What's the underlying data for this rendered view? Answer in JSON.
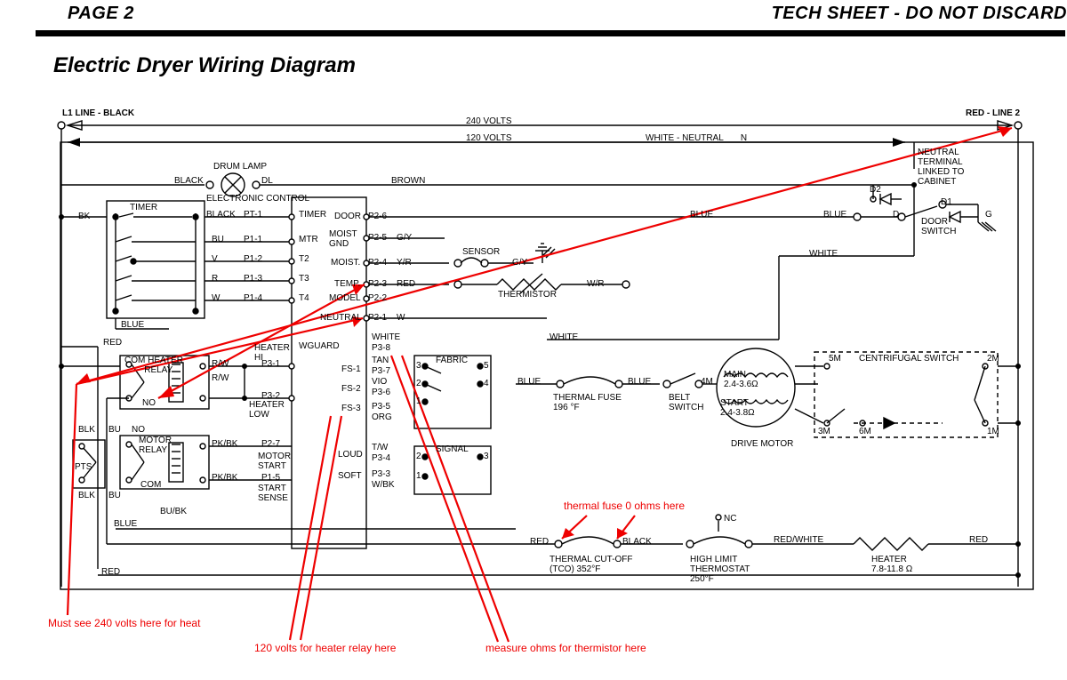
{
  "header": {
    "page": "PAGE 2",
    "tech": "TECH SHEET - DO NOT DISCARD",
    "title": "Electric Dryer Wiring Diagram"
  },
  "lines": {
    "l1": "L1 LINE - BLACK",
    "l2": "RED - LINE 2",
    "v240": "240 VOLTS",
    "v120": "120 VOLTS",
    "neutral": "WHITE - NEUTRAL       N",
    "neutralCab": "NEUTRAL\nTERMINAL\nLINKED TO\nCABINET"
  },
  "parts": {
    "drumLamp": "DRUM LAMP",
    "dl": "DL",
    "timer": "TIMER",
    "electronicControl": "ELECTRONIC CONTROL",
    "door": "DOOR",
    "doorSwitch": "DOOR\nSWITCH",
    "moistGnd": "MOIST\nGND",
    "moist": "MOIST.",
    "temp": "TEMP.",
    "model": "MODEL",
    "neutralPin": "NEUTRAL",
    "sensor": "SENSOR",
    "thermistor": "THERMISTOR",
    "wguard": "WGUARD",
    "fabric": "FABRIC",
    "signal": "SIGNAL",
    "heaterRelay": "COM HEATER\n        RELAY",
    "heaterHi": "HEATER\nHI",
    "heaterLow": "HEATER\nLOW",
    "motorRelay": "MOTOR\nRELAY",
    "motorStart": "MOTOR\nSTART",
    "startSense": "START\nSENSE",
    "loud": "LOUD",
    "soft": "SOFT",
    "thermalFuse": "THERMAL FUSE\n196 °F",
    "beltSwitch": "BELT\nSWITCH",
    "driveMotor": "DRIVE MOTOR",
    "main": "MAIN\n2.4-3.6Ω",
    "start": "START\n2.4-3.8Ω",
    "centSwitch": "CENTRIFUGAL SWITCH",
    "tco": "THERMAL CUT-OFF\n(TCO) 352°F",
    "hiLimit": "HIGH LIMIT\nTHERMOSTAT\n250°F",
    "heater": "HEATER\n7.8-11.8 Ω",
    "d1": "D1",
    "d2": "D2",
    "g": "G",
    "nc": "NC"
  },
  "wires": {
    "black": "BLACK",
    "brown": "BROWN",
    "blue": "BLUE",
    "white": "WHITE",
    "red": "RED",
    "blk": "BLK",
    "bu": "BU",
    "bk": "BK",
    "rw": "R/W",
    "wr": "W/R",
    "yr": "Y/R",
    "gy": "G/Y",
    "pkbk": "PK/BK",
    "bubk": "BU/BK",
    "tw": "T/W",
    "wbk": "W/BK",
    "tan": "TAN",
    "vio": "VIO",
    "org": "ORG",
    "w": "W",
    "redwhite": "RED/WHITE",
    "v": "V",
    "r": "R",
    "d": "D"
  },
  "pins": {
    "pt1": "PT-1",
    "p11": "P1-1",
    "p12": "P1-2",
    "p13": "P1-3",
    "p14": "P1-4",
    "p15": "P1-5",
    "p21": "P2-1",
    "p22": "P2-2",
    "p23": "P2-3",
    "p24": "P2-4",
    "p25": "P2-5",
    "p26": "P2-6",
    "p27": "P2-7",
    "p31": "P3-1",
    "p32": "P3-2",
    "p33": "P3-3",
    "p34": "P3-4",
    "p35": "P3-5",
    "p36": "P3-6",
    "p37": "P3-7",
    "p38": "P3-8",
    "fs1": "FS-1",
    "fs2": "FS-2",
    "fs3": "FS-3",
    "mtr": "MTR",
    "t2": "T2",
    "t3": "T3",
    "t4": "T4",
    "m1": "1M",
    "m2": "2M",
    "m3": "3M",
    "m4": "4M",
    "m5": "5M",
    "m6": "6M",
    "com": "COM",
    "no": "NO",
    "pts": "PTS",
    "n1": "1",
    "n2": "2",
    "n3": "3",
    "n4": "4",
    "n5": "5"
  },
  "annotations": {
    "a240": "Must see 240 volts here for heat",
    "a120": "120 volts for heater relay here",
    "aOhms": "measure ohms for thermistor here",
    "aFuse": "thermal fuse 0 ohms here"
  }
}
